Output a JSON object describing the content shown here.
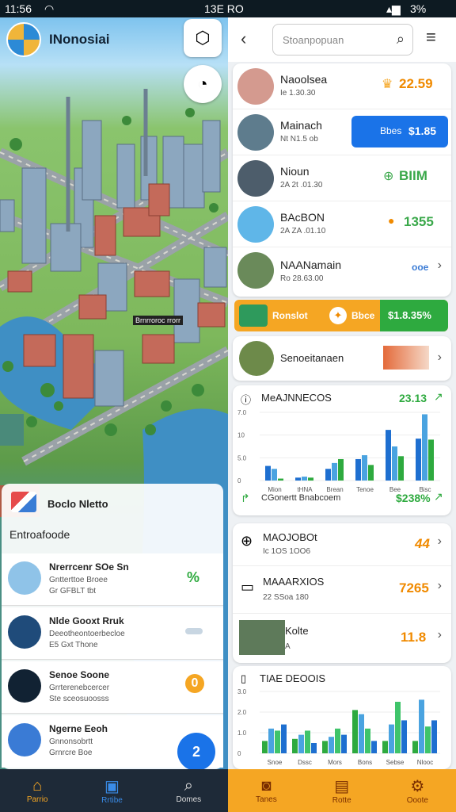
{
  "status": {
    "time": "11:56",
    "carrier": "13E RO",
    "battery": "3%"
  },
  "left": {
    "app_title": "INonosiai",
    "map_label": "Brnrroroc rrorr",
    "panel_header": "Boclo Nletto",
    "panel_sub": "Entroafoode",
    "items": [
      {
        "title": "Nrerrcenr SOe Sn",
        "sub1": "Gntterttoe Broee",
        "sub2": "Gr GFBLT tbt",
        "badge": "%"
      },
      {
        "title": "Nlde Gooxt Rruk",
        "sub1": "Deeotheontoerbecloe",
        "sub2": "E5 Gxt Thone",
        "badge": ""
      },
      {
        "title": "Senoe Soone",
        "sub1": "Grrterenebcercer",
        "sub2": "Ste sceosuoosss",
        "badge": "0"
      },
      {
        "title": "Ngerne Eeoh",
        "sub1": "Gnnonsobrtt",
        "sub2": "Grnrcre Boe",
        "badge": "2"
      }
    ],
    "nav": [
      "Parrio",
      "Rrtibe",
      "Domes"
    ]
  },
  "right": {
    "search_placeholder": "Stoanpopuan",
    "list": [
      {
        "title": "Naoolsea",
        "sub": "Ie 1.30.30",
        "value": "22.59",
        "color": "#f08a00"
      },
      {
        "title": "Mainach",
        "sub": "Nt N1.5 ob",
        "value": "$1.85",
        "button": "Bbes",
        "color": "#ffffff"
      },
      {
        "title": "Nioun",
        "sub": "2A 2t .01.30",
        "value": "BIIM",
        "color": "#3aa84a"
      },
      {
        "title": "BAcBON",
        "sub": "2A ZA .01.10",
        "value": "1355",
        "color": "#3aa84a"
      },
      {
        "title": "NAANamain",
        "sub": "Ro 28.63.00",
        "value": "ooe",
        "color": "#3a7bd5"
      }
    ],
    "banner": {
      "left": "Ronslot",
      "mid": "Bbce",
      "right": "$1.8.35%"
    },
    "service": {
      "title": "Senoeitanaen"
    },
    "chart1": {
      "title": "MeAJNNECOS",
      "value": "23.13",
      "footer": "CGonertt Bnabcoem",
      "footer_value": "$238%",
      "ticks_y": [
        "7.0",
        "10",
        "5.0",
        "0"
      ],
      "ticks_x": [
        "Mion",
        "tHNA",
        "Brean",
        "Tenoe",
        "Bee",
        "Bisc"
      ]
    },
    "chart_data": [
      {
        "type": "bar",
        "title": "MeAJNNECOS",
        "categories": [
          "Mion",
          "tHNA",
          "Brean",
          "Tenoe",
          "Bee",
          "Bisc"
        ],
        "series": [
          {
            "values": [
              1.5,
              0.3,
              1.2,
              2.2,
              5.2,
              4.3
            ]
          },
          {
            "values": [
              1.2,
              0.4,
              1.8,
              2.6,
              3.5,
              6.8
            ]
          },
          {
            "values": [
              0.2,
              0.3,
              2.2,
              1.6,
              2.5,
              4.2
            ]
          }
        ],
        "ylim": [
          0,
          7.0
        ]
      },
      {
        "type": "bar",
        "title": "TIAE DEOOIS",
        "categories": [
          "Snoe",
          "Dssc",
          "Mors",
          "Bons",
          "Sebse",
          "Nlooc"
        ],
        "series": [
          {
            "values": [
              0.6,
              0.7,
              0.6,
              2.1,
              0.6,
              0.6
            ]
          },
          {
            "values": [
              1.2,
              0.9,
              0.8,
              1.9,
              1.4,
              2.6
            ]
          },
          {
            "values": [
              1.1,
              1.1,
              1.2,
              1.2,
              2.5,
              1.3
            ]
          },
          {
            "values": [
              1.4,
              0.5,
              0.9,
              0.6,
              1.6,
              1.6
            ]
          }
        ],
        "ylim": [
          0,
          3.0
        ]
      }
    ],
    "chart2": {
      "title": "TIAE DEOOIS",
      "ticks_y": [
        "3.0",
        "2.0",
        "1.0",
        "0"
      ],
      "ticks_x": [
        "Snoe",
        "Dssc",
        "Mors",
        "Bons",
        "Sebse",
        "Nlooc"
      ]
    },
    "list2": [
      {
        "title": "MAOJOBOt",
        "sub": "Ic 1OS 1OO6",
        "value": "44",
        "color": "#f08a00"
      },
      {
        "title": "MAAARXIOS",
        "sub": "22 SSoa 180",
        "value": "7265",
        "color": "#f08a00"
      },
      {
        "title": "Kolte",
        "sub": "A",
        "value": "11.8",
        "color": "#f08a00"
      }
    ],
    "nav": [
      "Tanes",
      "Rotte",
      "Ooote"
    ]
  },
  "colors": {
    "accent": "#1a73e8",
    "orange": "#f5a623",
    "green": "#2eaa3f"
  }
}
